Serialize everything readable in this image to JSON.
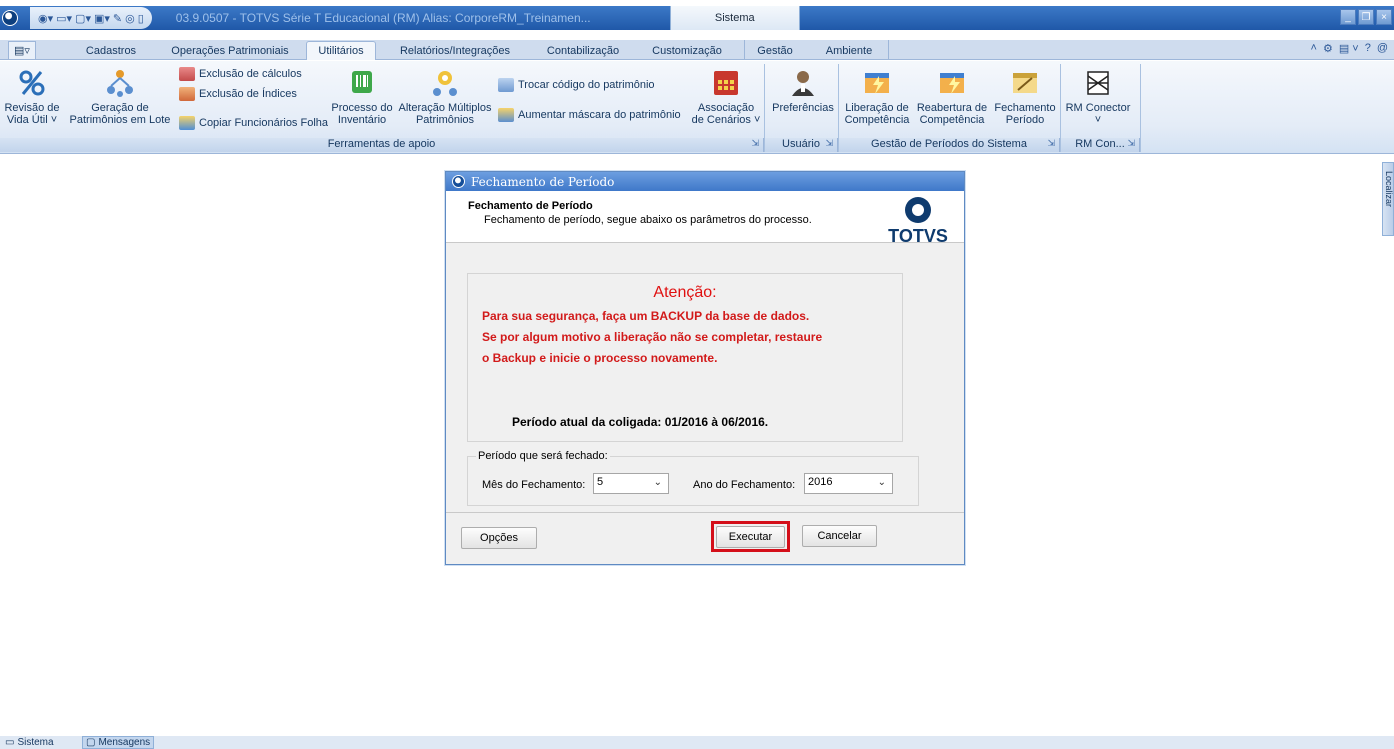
{
  "titlebar": {
    "title": "03.9.0507 - TOTVS Série T Educacional (RM) Alias: CorporeRM_Treinamen...",
    "context_tab": "Sistema",
    "window_controls": [
      "minimize-icon",
      "restore-icon",
      "close-icon"
    ]
  },
  "tabs": {
    "app_menu": "▤▿",
    "items": [
      "Cadastros",
      "Operações Patrimoniais",
      "Utilitários",
      "Relatórios/Integrações",
      "Contabilização",
      "Customização",
      "Gestão",
      "Ambiente"
    ],
    "active": "Utilitários",
    "right_tools": [
      "˄",
      "⚙",
      "▤ ˅",
      "?",
      "@"
    ]
  },
  "ribbon": {
    "revisao": {
      "line1": "Revisão de",
      "line2": "Vida Útil ˅"
    },
    "geracao": {
      "line1": "Geração de",
      "line2": "Patrimônios em Lote"
    },
    "exclusao_calculos": "Exclusão de cálculos",
    "exclusao_indices": "Exclusão de Índices",
    "copiar_funcionarios": "Copiar Funcionários Folha",
    "processo_inventario": {
      "line1": "Processo do",
      "line2": "Inventário"
    },
    "alteracao_multiplos": {
      "line1": "Alteração Múltiplos",
      "line2": "Patrimônios"
    },
    "trocar_codigo": "Trocar código do patrimônio",
    "aumentar_mascara": "Aumentar máscara do patrimônio",
    "associacao": {
      "line1": "Associação",
      "line2": "de Cenários ˅"
    },
    "preferencias": "Preferências",
    "liberacao": {
      "line1": "Liberação de",
      "line2": "Competência"
    },
    "reabertura": {
      "line1": "Reabertura de",
      "line2": "Competência"
    },
    "fechamento": {
      "line1": "Fechamento",
      "line2": "Período"
    },
    "rm_conector": {
      "line1": "RM Conector",
      "line2": "˅"
    },
    "groups": {
      "ferramentas": "Ferramentas de apoio",
      "usuario": "Usuário",
      "gestao_periodos": "Gestão de Períodos do Sistema",
      "rm_con": "RM Con..."
    }
  },
  "dialog": {
    "title": "Fechamento de Período",
    "header_title": "Fechamento de Período",
    "header_subtitle": "Fechamento de período, segue abaixo os parâmetros do processo.",
    "logo_text": "TOTVS",
    "warning": {
      "title": "Atenção:",
      "line1": "Para sua segurança, faça um BACKUP da base de dados.",
      "line2": "Se por algum motivo a liberação não se completar, restaure",
      "line3": "o Backup e inicie o processo novamente.",
      "periodo": "Período atual da coligada: 01/2016 à 06/2016."
    },
    "fieldset_legend": "Período que será fechado:",
    "mes_label": "Mês do Fechamento:",
    "mes_value": "5",
    "ano_label": "Ano do Fechamento:",
    "ano_value": "2016",
    "btn_opcoes": "Opções",
    "btn_executar": "Executar",
    "btn_cancelar": "Cancelar",
    "highlight_color": "#d40f1a"
  },
  "sidetab": {
    "label": "Localizar"
  },
  "statusbar": {
    "sistema": "Sistema",
    "mensagens": "Mensagens"
  }
}
